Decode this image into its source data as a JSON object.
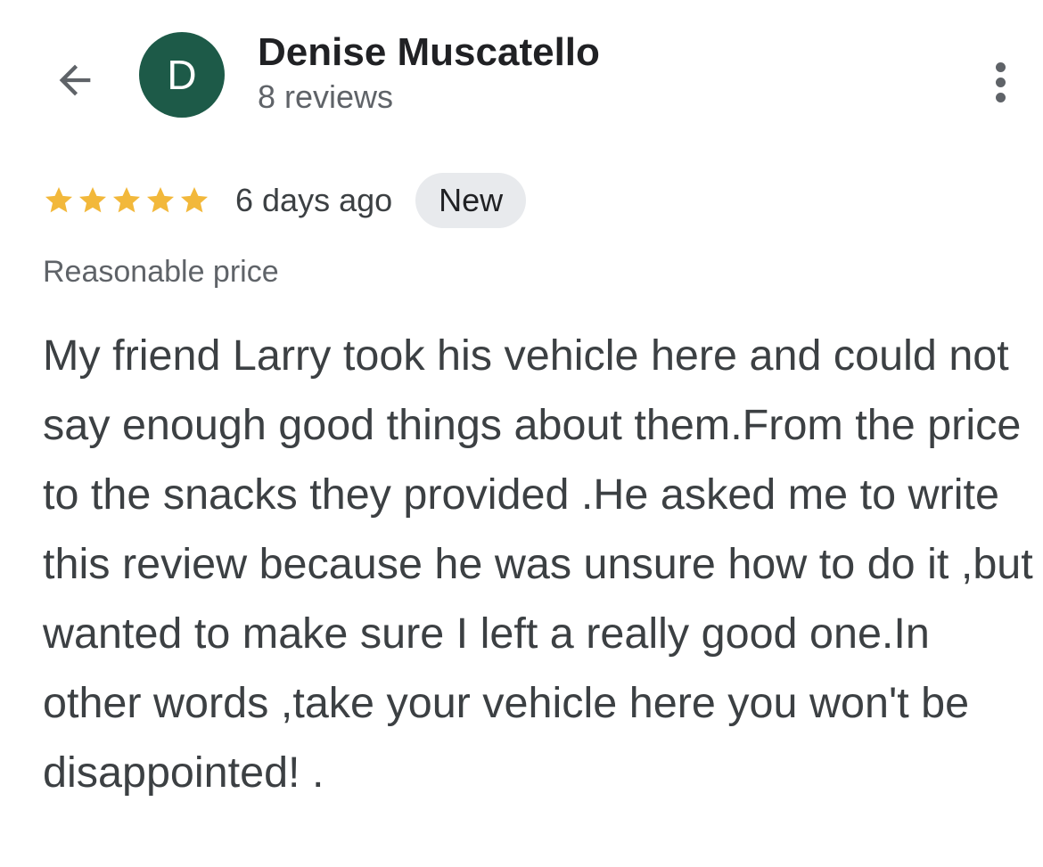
{
  "header": {
    "back_icon": "arrow-left-icon",
    "avatar_initial": "D",
    "avatar_color": "#1d5a48",
    "user_name": "Denise Muscatello",
    "review_count": "8 reviews",
    "more_icon": "more-vertical-icon"
  },
  "review": {
    "rating": 5,
    "rating_max": 5,
    "star_color": "#f2b83b",
    "date": "6 days ago",
    "badge": "New",
    "attribute": "Reasonable price",
    "text": "My friend Larry took his vehicle here and could not say enough good things about them.From the price to the snacks they provided .He asked me to write this review because he was unsure how to do it ,but wanted to make sure I left a really good one.In other words ,take your vehicle here you won't be disappointed! ."
  }
}
